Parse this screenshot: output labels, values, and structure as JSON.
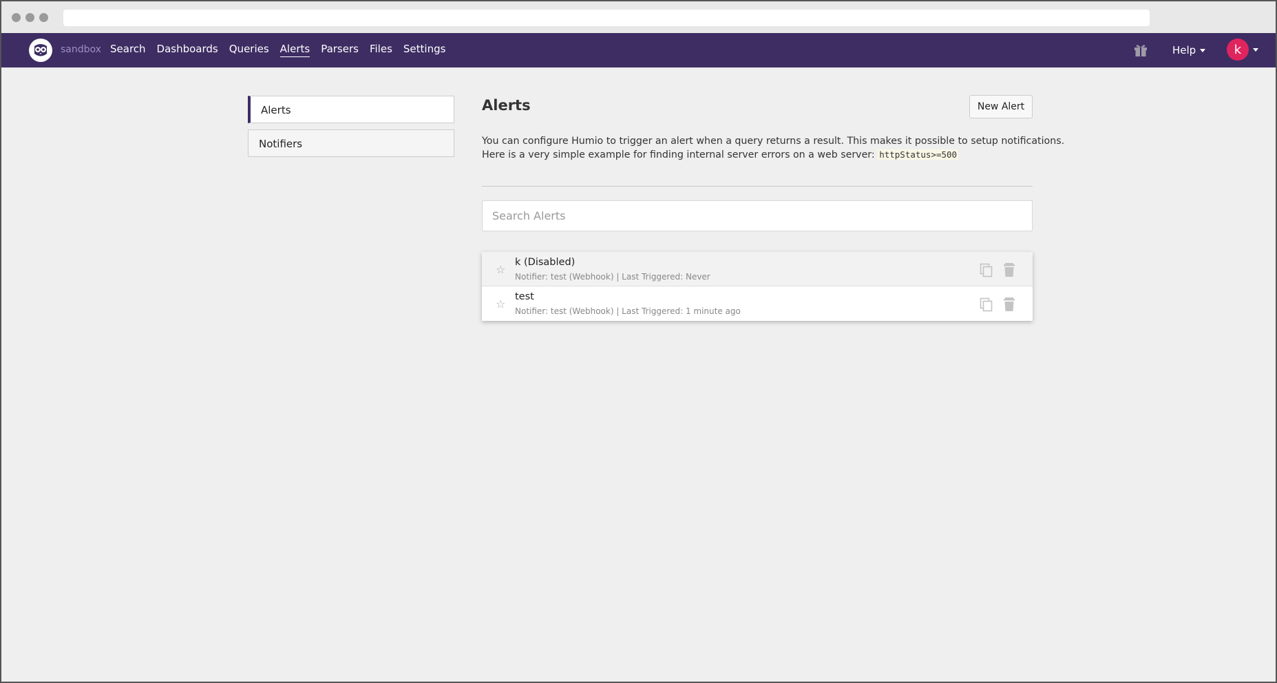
{
  "navbar": {
    "repo": "sandbox",
    "links": [
      "Search",
      "Dashboards",
      "Queries",
      "Alerts",
      "Parsers",
      "Files",
      "Settings"
    ],
    "active_link": "Alerts",
    "help_label": "Help",
    "user_initial": "k",
    "bg_color": "#3d2d63",
    "avatar_color": "#e0245e"
  },
  "sidebar": {
    "items": [
      {
        "label": "Alerts",
        "active": true
      },
      {
        "label": "Notifiers",
        "active": false
      }
    ]
  },
  "main": {
    "title": "Alerts",
    "new_button": "New Alert",
    "description_line1": "You can configure Humio to trigger an alert when a query returns a result. This makes it possible to setup notifications.",
    "description_line2": "Here is a very simple example for finding internal server errors on a web server: ",
    "example_code": "httpStatus>=500",
    "search_placeholder": "Search Alerts",
    "alerts": [
      {
        "name": "k (Disabled)",
        "meta": "Notifier: test (Webhook) | Last Triggered: Never",
        "disabled": true
      },
      {
        "name": "test",
        "meta": "Notifier: test (Webhook) | Last Triggered: 1 minute ago",
        "disabled": false
      }
    ]
  },
  "icons": {
    "logo": "owl-logo-icon",
    "gift": "gift-icon",
    "star": "star-icon",
    "copy": "copy-icon",
    "trash": "trash-icon"
  }
}
